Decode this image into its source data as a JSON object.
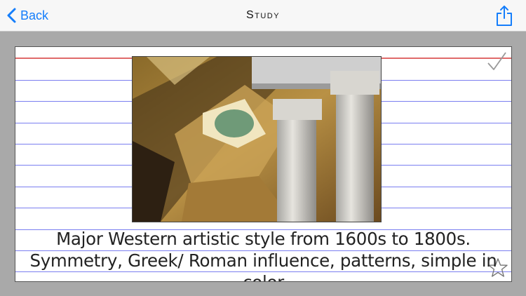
{
  "navbar": {
    "back_label": "Back",
    "title": "Study",
    "share_icon": "share-icon"
  },
  "card": {
    "definition": "Major Western artistic style from 1600s to 1800s. Symmetry, Greek/ Roman influence, patterns, simple in color",
    "image_name": "neoclassical-ceiling-columns-photo",
    "check_icon": "checkmark-icon",
    "star_icon": "star-icon"
  },
  "colors": {
    "accent": "#157efb",
    "rule": "#7a7ef0",
    "margin_rule": "#e06b6b"
  }
}
